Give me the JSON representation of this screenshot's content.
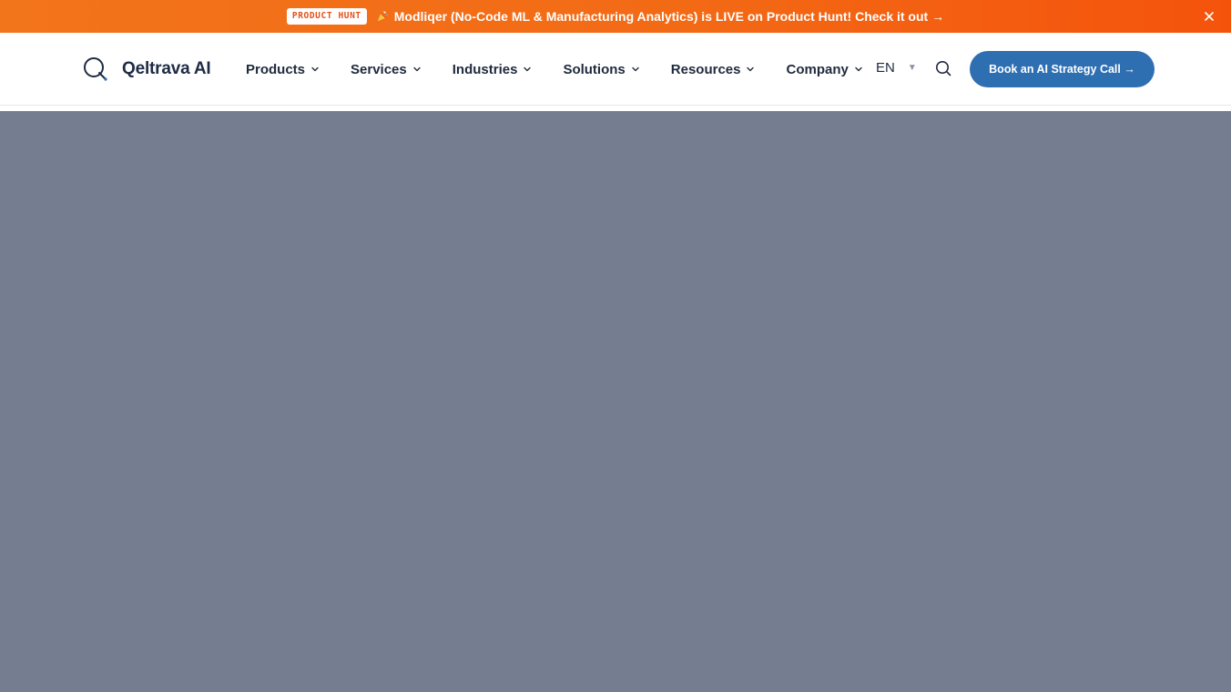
{
  "banner": {
    "badge": "PRODUCT HUNT",
    "message": "Modliqer (No-Code ML & Manufacturing Analytics) is LIVE on Product Hunt! Check it out →",
    "icon": "party-popper-icon",
    "close_icon": "close-icon",
    "colors": {
      "gradient_start": "#f2741b",
      "gradient_end": "#f4530c"
    }
  },
  "nav": {
    "brand": "Qeltrava AI",
    "logo_icon": "q-logo-icon",
    "menu": [
      {
        "label": "Products"
      },
      {
        "label": "Services"
      },
      {
        "label": "Industries"
      },
      {
        "label": "Solutions"
      },
      {
        "label": "Resources"
      },
      {
        "label": "Company"
      }
    ],
    "language": "EN",
    "search_icon": "search-icon",
    "cta_label": "Book an AI Strategy Call →",
    "colors": {
      "cta": "#2e6fb2",
      "text": "#1f2a3d"
    }
  },
  "overlay": {
    "color": "#757d90"
  }
}
